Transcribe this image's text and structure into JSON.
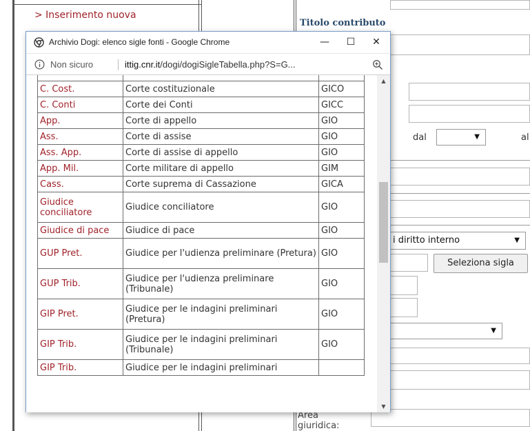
{
  "background": {
    "link": "> Inserimento nuova",
    "heading": "Titolo contributo",
    "date_from_label": "dal",
    "date_to_label": "al",
    "select_diritto": "i diritto interno",
    "select_sigla_button": "Seleziona sigla",
    "area_label": "Area giuridica:"
  },
  "popup": {
    "title": "Archivio Dogi: elenco sigle fonti - Google Chrome",
    "minimize": "—",
    "maximize": "☐",
    "close": "✕",
    "not_secure": "Non sicuro",
    "url_host": "ittig.cnr.it",
    "url_path": "/dogi/dogiSigleTabella.php?S=G...",
    "rows": [
      {
        "sigla": "C. Cost.",
        "descr": "Corte costituzionale",
        "cod": "GICO"
      },
      {
        "sigla": "C. Conti",
        "descr": "Corte dei Conti",
        "cod": "GICC"
      },
      {
        "sigla": "App.",
        "descr": "Corte di appello",
        "cod": "GIO"
      },
      {
        "sigla": "Ass.",
        "descr": "Corte di assise",
        "cod": "GIO"
      },
      {
        "sigla": "Ass. App.",
        "descr": "Corte di assise di appello",
        "cod": "GIO"
      },
      {
        "sigla": "App. Mil.",
        "descr": "Corte militare di appello",
        "cod": "GIM"
      },
      {
        "sigla": "Cass.",
        "descr": "Corte suprema di Cassazione",
        "cod": "GICA"
      },
      {
        "sigla": "Giudice conciliatore",
        "descr": "Giudice conciliatore",
        "cod": "GIO"
      },
      {
        "sigla": "Giudice di pace",
        "descr": "Giudice di pace",
        "cod": "GIO"
      },
      {
        "sigla": "GUP Pret.",
        "descr": "Giudice per l'udienza preliminare (Pretura)",
        "cod": "GIO"
      },
      {
        "sigla": "GUP Trib.",
        "descr": "Giudice per l'udienza preliminare (Tribunale)",
        "cod": "GIO"
      },
      {
        "sigla": "GIP Pret.",
        "descr": "Giudice per le indagini preliminari (Pretura)",
        "cod": "GIO"
      },
      {
        "sigla": "GIP Trib.",
        "descr": "Giudice per le indagini preliminari (Tribunale)",
        "cod": "GIO"
      },
      {
        "sigla": "GIP Trib.",
        "descr": "Giudice per le indagini preliminari",
        "cod": ""
      }
    ],
    "icons": {
      "chrome": "chrome-icon",
      "info": "info-icon",
      "zoom": "zoom-icon",
      "scroll_up": "scroll-up-arrow-icon",
      "scroll_down": "scroll-down-arrow-icon"
    }
  }
}
